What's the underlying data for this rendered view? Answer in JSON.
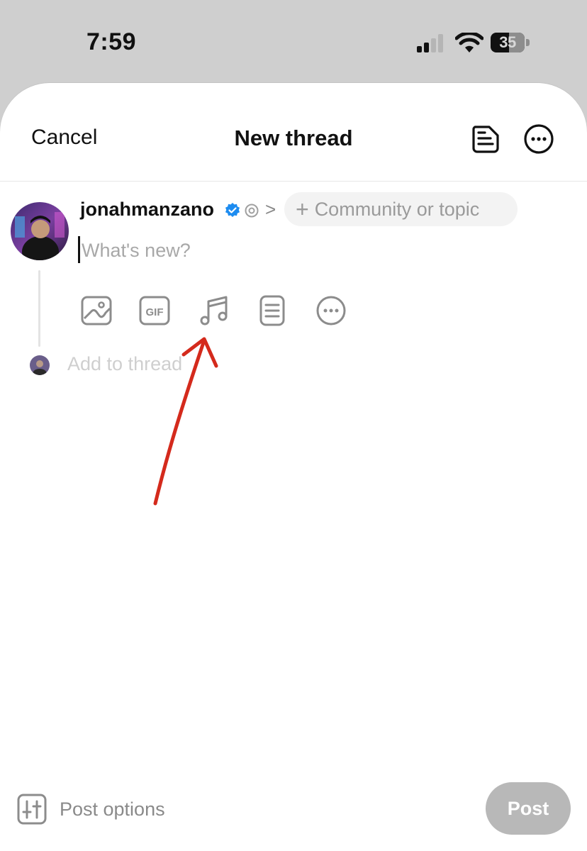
{
  "status_bar": {
    "time": "7:59",
    "battery": "35"
  },
  "header": {
    "cancel_label": "Cancel",
    "title": "New thread"
  },
  "composer": {
    "username": "jonahmanzano",
    "topic_label": "Community or topic",
    "topic_plus": "+",
    "chevron": ">",
    "placeholder": "What's new?",
    "attachments": [
      "image-icon",
      "gif-icon",
      "music-icon",
      "poll-icon",
      "more-icon"
    ]
  },
  "add_thread_label": "Add to thread",
  "footer": {
    "post_options_label": "Post options",
    "post_label": "Post"
  },
  "colors": {
    "accent_annotation": "#d42a1c",
    "verified_blue": "#1d8cf0",
    "disabled_button": "#b8b8b8"
  }
}
